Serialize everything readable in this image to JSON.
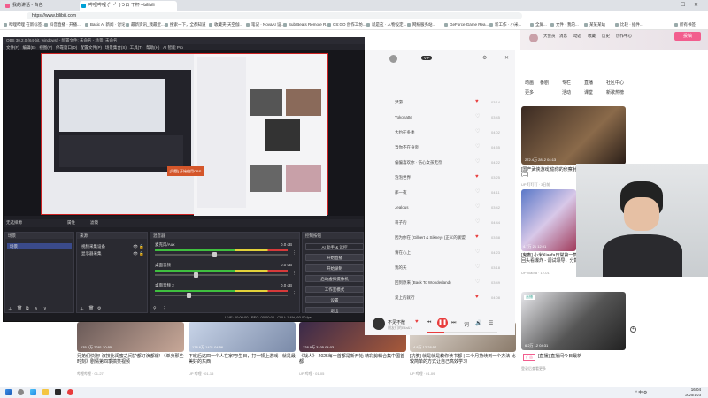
{
  "browser": {
    "tabs": [
      {
        "label": "我的讲话 - 白色"
      },
      {
        "label": "哔哩哔哩 (゜-゜)つロ 干杯~-bilibili",
        "active": true
      }
    ],
    "window_controls": [
      "—",
      "☐",
      "✕"
    ],
    "url": "https://www.bilibili.com",
    "bookmarks": [
      "哔哩哔哩 在新标签...",
      "抖音直播 · 开播...",
      "Basic AI 新闻 · 讨论",
      "最新资讯_我最近...",
      "搜索一下，全都知道",
      "收藏夹-天空伽...",
      "笔记 · NovaAI 设...",
      "Sub Beats Remote R...",
      "CS:GO 创作工坊...",
      "就是这 · 人物设定...",
      "网络服务站...",
      "GeForce Game Rea...",
      "新工作 · 小米...",
      "全屏...",
      "文件 · 我的...",
      "某某某站",
      "比较 · 插件..."
    ],
    "right_bookmark": "所有书签"
  },
  "bili": {
    "header_links": [
      "大会员",
      "消息",
      "动态",
      "收藏",
      "历史",
      "创作中心"
    ],
    "upload_label": "投稿",
    "categories_top": [
      "动画",
      "番剧",
      "国创",
      "综艺",
      "纪录片",
      "更多"
    ],
    "categories_right": [
      "专栏",
      "直播",
      "活动",
      "课堂",
      "社区中心",
      "新歌热榜"
    ],
    "cards_right": [
      {
        "title": "[国产武侠游戏]偷你的侦察射击(二)",
        "meta": "UP 叮叮叮 · 3日前",
        "stats": "272.4万  2812  04:13"
      },
      {
        "title": "[鬼畜] 小米Xiaofa日常第一集就爆炸时间，真的人从不回头看爆炸 - 调试领导，分数列在~",
        "meta": "UP Xiaofa · 12-01",
        "stats": "4.7万  21  12:01"
      },
      {
        "title": "[舞蹈] 四位好看的跳舞现场",
        "meta": "UP 直播号 · 昨天",
        "stats": "6.2万  12  04:31"
      }
    ],
    "cards_bottom": [
      {
        "title": "兄弟们快跑! 演技比闺蜜之间护都好演都爆! 《单身那些时刻》剧情第四季搞笑视频",
        "meta": "哔哩哔哩 · 01-27",
        "stats": "135.2万  2281  30:55"
      },
      {
        "title": "下班后这四一个人在家吧!生日，打一顿上游戏 - 就是最美好的东西",
        "meta": "UP 哔哩 · 01-15",
        "stats": "178.6万  1421  04:56"
      },
      {
        "title": "《战人》-2025每一首都是新开始 精彩剪辑合集中国首都",
        "meta": "UP 哔哩 · 01-05",
        "stats": "128.9万  3105  04:03"
      },
      {
        "title": "[坑爹] 就是就是教你读书都 | 三个月持续到一个方法 比较简单的方式让自己高效学习",
        "meta": "UP 哔哩 · 01-09",
        "stats": "4.8万  12  28:57"
      }
    ],
    "ad_badge": "广告",
    "live_badge": "直播",
    "live_title": "[直播] 直播间今日最新",
    "upcoming_label": "登录后查看更多",
    "bottom_stamp": "专栏号"
  },
  "obs": {
    "title": "OBS 30.2.0 (64-bit, windows) - 配置文件: 未命名 - 场景: 未命名",
    "menu": [
      "文件(F)",
      "编辑(E)",
      "视图(V)",
      "停靠窗口(D)",
      "配置文件(P)",
      "场景集合(S)",
      "工具(T)",
      "帮助(H)",
      "AI 智能 Pro"
    ],
    "source_bar": [
      "无选择源",
      "属性",
      "滤镜"
    ],
    "popup": "[问题] 开始使用OBS",
    "scenes": {
      "header": "场景",
      "items": [
        "场景"
      ]
    },
    "sources": {
      "header": "来源",
      "items": [
        "视频采集设备",
        "显示器采集"
      ]
    },
    "mixer": {
      "header": "混音器",
      "channels": [
        {
          "name": "麦克风/Aux",
          "db": "0.0 dB",
          "level": 0.45
        },
        {
          "name": "桌面音频",
          "db": "0.0 dB",
          "level": 0.3
        },
        {
          "name": "桌面音频 2",
          "db": "0.0 dB",
          "level": 0.25
        }
      ]
    },
    "transitions": {
      "header": "转场特效"
    },
    "controls": {
      "header": "控制按钮",
      "buttons": [
        "开始直播",
        "开始录制",
        "启动虚拟摄像机",
        "工作室模式",
        "设置",
        "退出"
      ],
      "extra_buttons": [
        "直播设置",
        "提示"
      ],
      "ai_button": "AI 助手 & 远控"
    },
    "status": {
      "live": "LIVE: 00:00:00",
      "rec": "REC: 00:00:00",
      "cpu": "CPU: 1.4%, 60.00 fps"
    }
  },
  "music": {
    "songs": [
      {
        "title": "梦游",
        "dur": "03:14",
        "liked": true
      },
      {
        "title": "Yokonatte",
        "dur": "03:45",
        "liked": false
      },
      {
        "title": "大约在冬季",
        "dur": "04:02",
        "liked": false
      },
      {
        "title": "当你不在身旁",
        "dur": "04:55",
        "liked": false
      },
      {
        "title": "偏偏喜欢你 · 伤心女孩无奈",
        "dur": "04:22",
        "liked": false
      },
      {
        "title": "泡泡世界",
        "dur": "03:25",
        "liked": true
      },
      {
        "title": "那一夜",
        "dur": "04:11",
        "liked": false
      },
      {
        "title": "Jealous",
        "dur": "03:42",
        "liked": false
      },
      {
        "title": "哥子的",
        "dur": "04:44",
        "liked": false
      },
      {
        "title": "因为你在 (Gilbert & Sikney) (正义的联盟)",
        "dur": "03:58",
        "liked": true
      },
      {
        "title": "请在心上",
        "dur": "04:23",
        "liked": false
      },
      {
        "title": "我的天",
        "dur": "03:18",
        "liked": false
      },
      {
        "title": "回到原来 (Back To Wonderland)",
        "dur": "03:49",
        "liked": false
      },
      {
        "title": "爱上的就行",
        "dur": "04:08",
        "liked": true
      }
    ],
    "now_playing": {
      "title": "不见不散",
      "artist": "朋友们的Ella&Y"
    },
    "progress": 0.25,
    "volume_icon": "speaker-icon"
  },
  "taskbar": {
    "time": "16:04",
    "date": "2025/1/23",
    "tray_text": "^ 中 ⚙"
  },
  "colors": {
    "bili_pink": "#f25d8e",
    "obs_bg": "#1f1f25",
    "music_red": "#e83c3c"
  }
}
